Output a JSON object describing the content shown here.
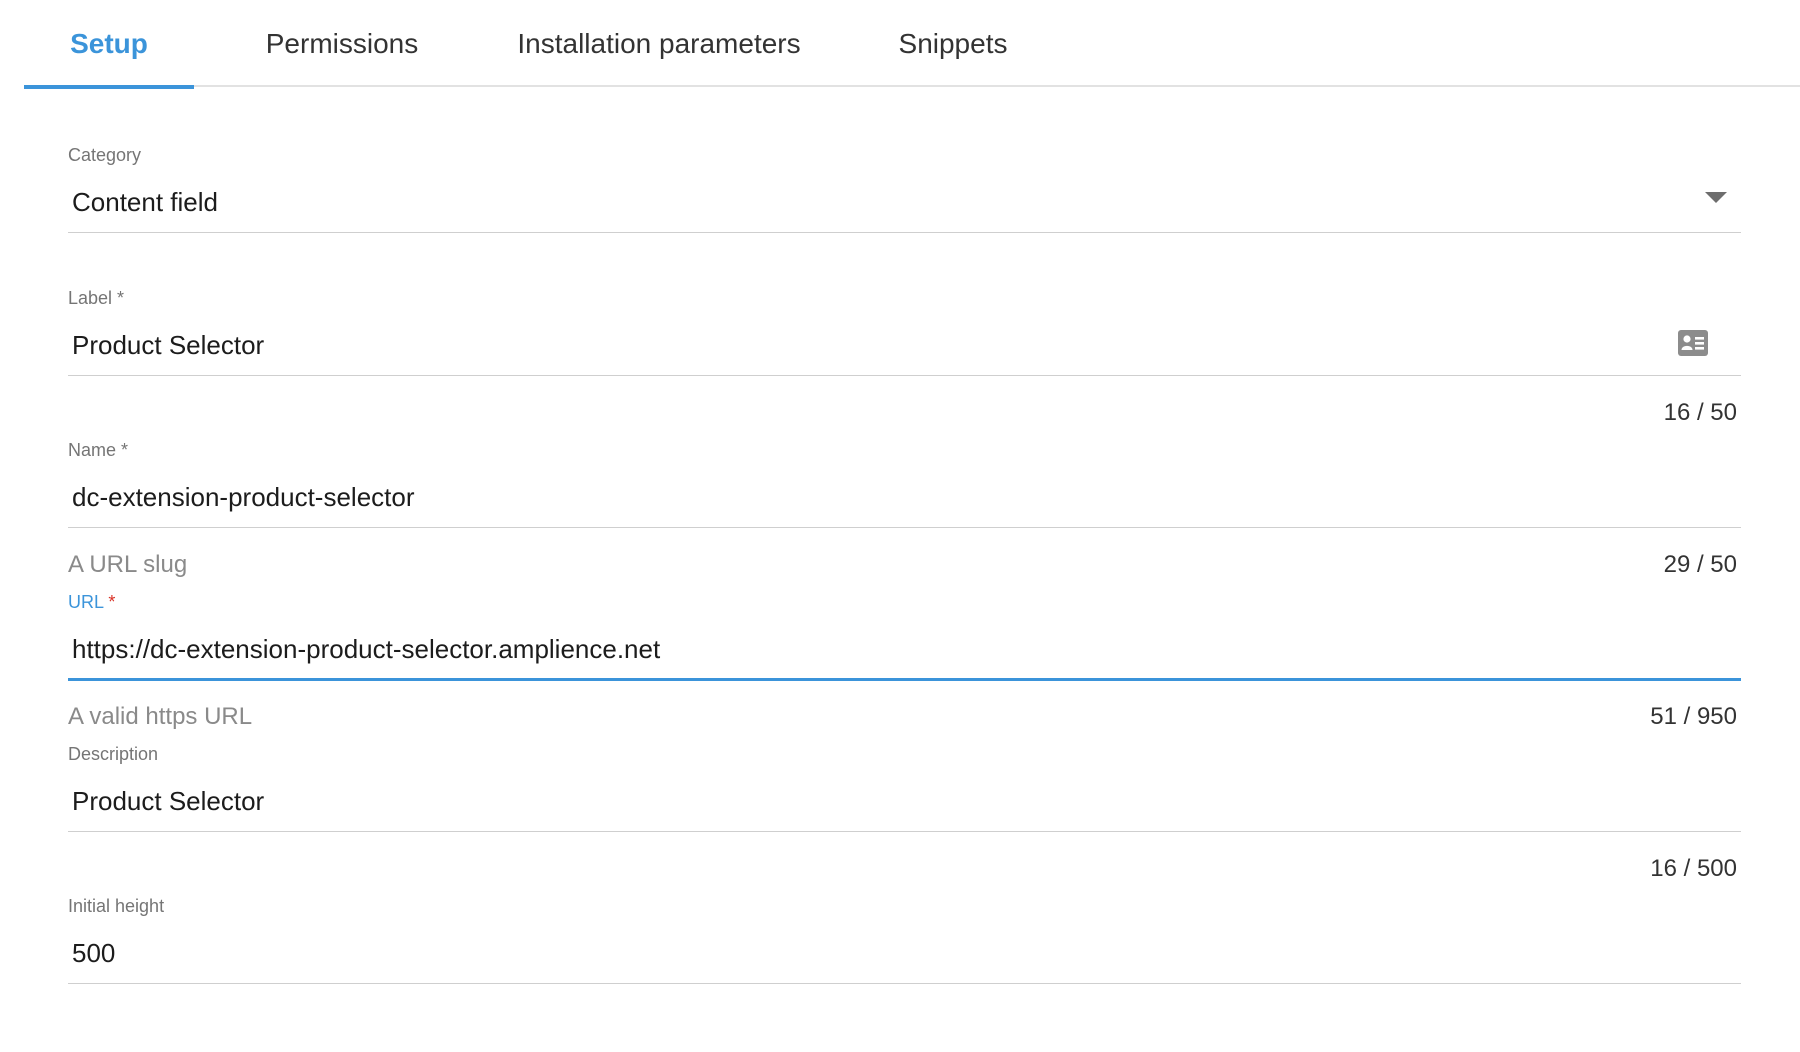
{
  "tabs": [
    {
      "label": "Setup",
      "active": true
    },
    {
      "label": "Permissions",
      "active": false
    },
    {
      "label": "Installation parameters",
      "active": false
    },
    {
      "label": "Snippets",
      "active": false
    }
  ],
  "form": {
    "category": {
      "label": "Category",
      "value": "Content field",
      "icon": "chevron-down-icon"
    },
    "label": {
      "label": "Label *",
      "value": "Product Selector",
      "counter": "16 / 50",
      "icon": "contact-card-icon"
    },
    "name": {
      "label": "Name *",
      "value": "dc-extension-product-selector",
      "helper": "A URL slug",
      "counter": "29 / 50"
    },
    "url": {
      "label": "URL",
      "required_mark": "*",
      "value": "https://dc-extension-product-selector.amplience.net",
      "helper": "A valid https URL",
      "counter": "51 / 950",
      "focused": true
    },
    "description": {
      "label": "Description",
      "value": "Product Selector",
      "counter": "16 / 500"
    },
    "initial_height": {
      "label": "Initial height",
      "value": "500"
    }
  },
  "colors": {
    "accent": "#3b94da",
    "required": "#d93025",
    "divider": "#cfcfcf",
    "label": "#757575"
  }
}
